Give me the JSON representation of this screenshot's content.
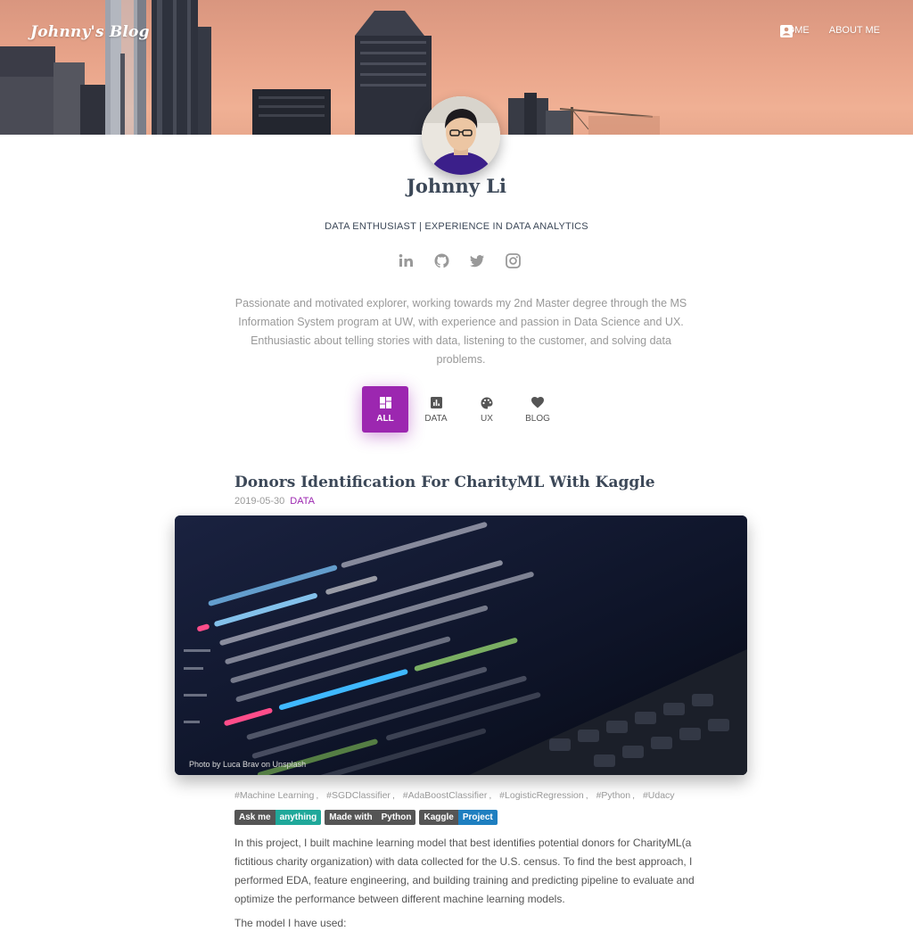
{
  "header": {
    "brand": "Johnny's Blog",
    "nav": [
      {
        "label": "HOME",
        "icon": "home-icon"
      },
      {
        "label": "ABOUT ME",
        "icon": "account-box-icon"
      }
    ]
  },
  "profile": {
    "name": "Johnny Li",
    "tagline": "DATA ENTHUSIAST | EXPERIENCE IN DATA ANALYTICS",
    "social": [
      "linkedin-icon",
      "github-icon",
      "twitter-icon",
      "instagram-icon"
    ],
    "bio": "Passionate and motivated explorer, working towards my 2nd Master degree through the MS Information System program at UW, with experience and passion in Data Science and UX. Enthusiastic about telling stories with data, listening to the customer, and solving data problems."
  },
  "filters": [
    {
      "label": "ALL",
      "icon": "dashboard-icon",
      "active": true
    },
    {
      "label": "DATA",
      "icon": "chart-icon",
      "active": false
    },
    {
      "label": "UX",
      "icon": "palette-icon",
      "active": false
    },
    {
      "label": "BLOG",
      "icon": "heart-icon",
      "active": false
    }
  ],
  "post": {
    "title": "Donors Identification For CharityML With Kaggle",
    "date": "2019-05-30",
    "category": "DATA",
    "image_credit": "Photo by Luca Brav on Unsplash",
    "tags": [
      "#Machine Learning",
      "#SGDClassifier",
      "#AdaBoostClassifier",
      "#LogisticRegression",
      "#Python",
      "#Udacy"
    ],
    "badges": [
      {
        "left": "Ask me",
        "right": "anything",
        "color": "#1fa89a"
      },
      {
        "left": "Made with",
        "right": "Python",
        "color": "#555555"
      },
      {
        "left": "Kaggle",
        "right": "Project",
        "color": "#1e7fc0"
      }
    ],
    "description": "In this project, I built machine learning model that best identifies potential donors for CharityML(a fictitious charity organization) with data collected for the U.S. census. To find the best approach, I performed EDA, feature engineering, and building training and predicting pipeline to evaluate and optimize the performance between different machine learning models.",
    "models_intro": "The model I have used:"
  },
  "colors": {
    "accent": "#9c27b0",
    "text": "#3c4858",
    "muted": "#999999"
  }
}
